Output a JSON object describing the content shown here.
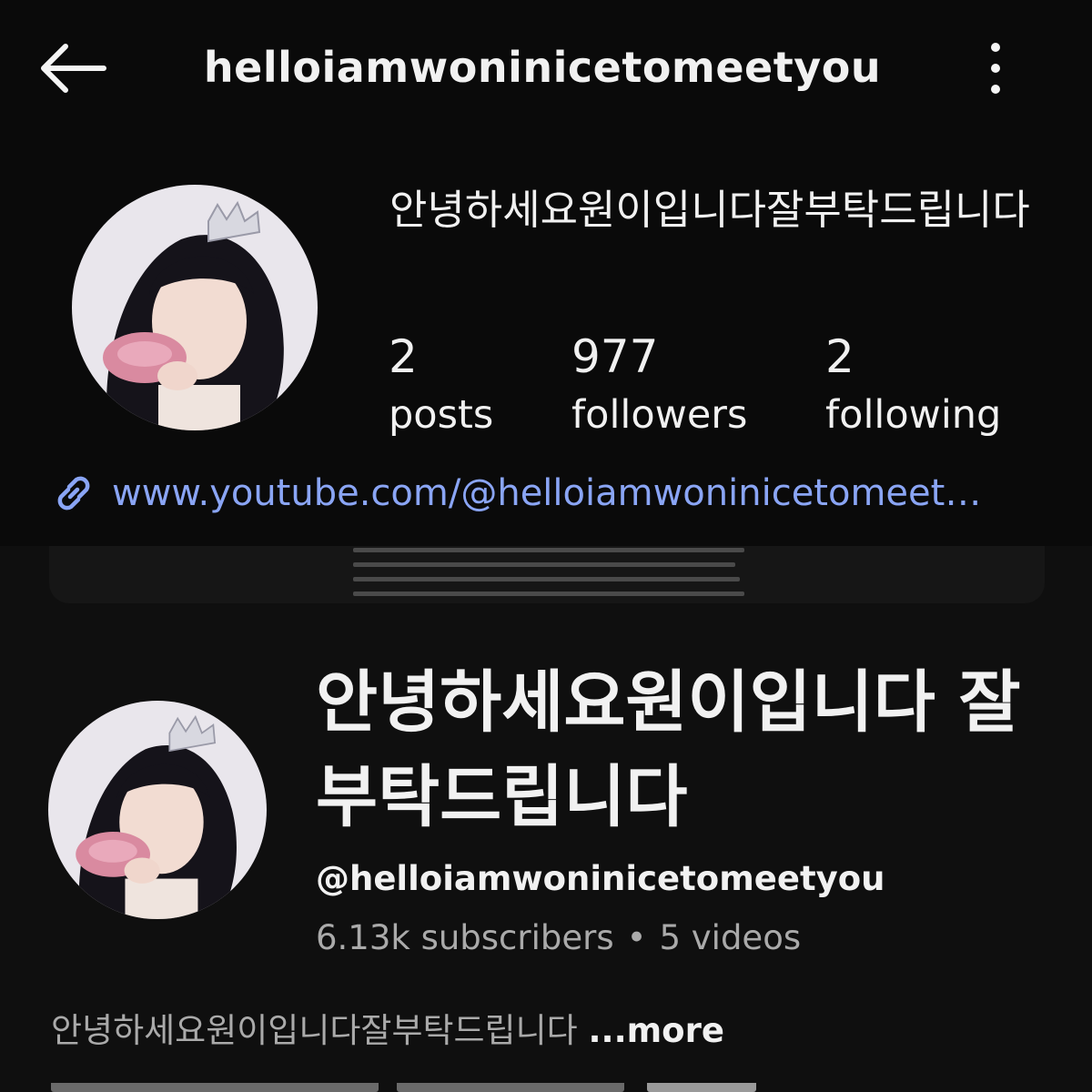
{
  "instagram": {
    "header": {
      "username": "helloiamwoninicetomeetyou",
      "back_icon": "arrow-left-icon",
      "menu_icon": "more-vertical-icon"
    },
    "profile": {
      "display_name": "안녕하세요원이입니다잘부탁드립니다",
      "stats": {
        "posts": {
          "count": "2",
          "label": "posts"
        },
        "followers": {
          "count": "977",
          "label": "followers"
        },
        "following": {
          "count": "2",
          "label": "following"
        }
      },
      "link": {
        "icon": "link-icon",
        "text": "www.youtube.com/@helloiamwoninicetomeet…"
      }
    }
  },
  "youtube": {
    "channel_name": "안녕하세요원이입니다 잘부탁드립니다",
    "handle": "@helloiamwoninicetomeetyou",
    "subscribers": "6.13k subscribers",
    "separator": "•",
    "videos": "5 videos",
    "description": "안녕하세요원이입니다잘부탁드립니다",
    "more_label": "...more"
  },
  "colors": {
    "background": "#0f0f0f",
    "link": "#8aa5f5",
    "secondary_text": "#aaaaaa"
  }
}
